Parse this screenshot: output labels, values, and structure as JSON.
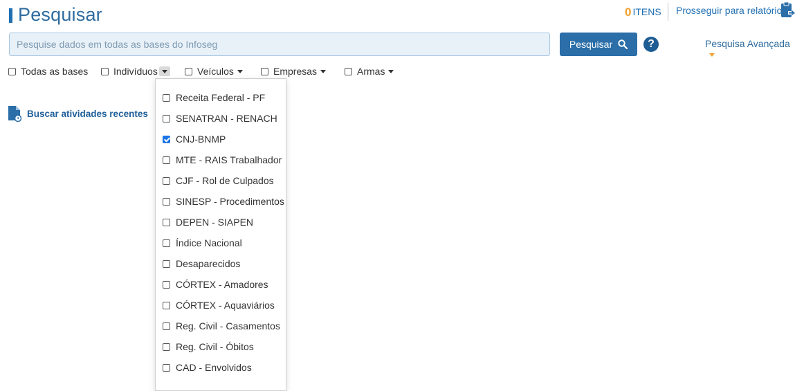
{
  "header": {
    "title": "Pesquisar",
    "items_count": "0",
    "items_label": "ITENS",
    "proceed_label": "Prosseguir para relatório"
  },
  "search": {
    "placeholder": "Pesquise dados em todas as bases do Infoseg",
    "value": "",
    "button_label": "Pesquisar",
    "help_label": "?",
    "advanced_label": "Pesquisa Avançada"
  },
  "filters": [
    {
      "label": "Todas as bases",
      "checked": false
    },
    {
      "label": "Indivíduos",
      "checked": false
    },
    {
      "label": "Veículos",
      "checked": false
    },
    {
      "label": "Empresas",
      "checked": false
    },
    {
      "label": "Armas",
      "checked": false
    }
  ],
  "recent": {
    "label": "Buscar atividades recentes"
  },
  "dropdown": {
    "items": [
      {
        "label": "Receita Federal - PF",
        "checked": false
      },
      {
        "label": "SENATRAN - RENACH",
        "checked": false
      },
      {
        "label": "CNJ-BNMP",
        "checked": true
      },
      {
        "label": "MTE - RAIS Trabalhador",
        "checked": false
      },
      {
        "label": "CJF - Rol de Culpados",
        "checked": false
      },
      {
        "label": "SINESP - Procedimentos",
        "checked": false
      },
      {
        "label": "DEPEN - SIAPEN",
        "checked": false
      },
      {
        "label": "Índice Nacional",
        "checked": false
      },
      {
        "label": "Desaparecidos",
        "checked": false
      },
      {
        "label": "CÓRTEX - Amadores",
        "checked": false
      },
      {
        "label": "CÓRTEX - Aquaviários",
        "checked": false
      },
      {
        "label": "Reg. Civil - Casamentos",
        "checked": false
      },
      {
        "label": "Reg. Civil - Óbitos",
        "checked": false
      },
      {
        "label": "CAD - Envolvidos",
        "checked": false
      }
    ]
  },
  "colors": {
    "primary": "#2b6ea8",
    "accent": "#f0a02b",
    "checkbox_checked": "#1a73e8"
  }
}
